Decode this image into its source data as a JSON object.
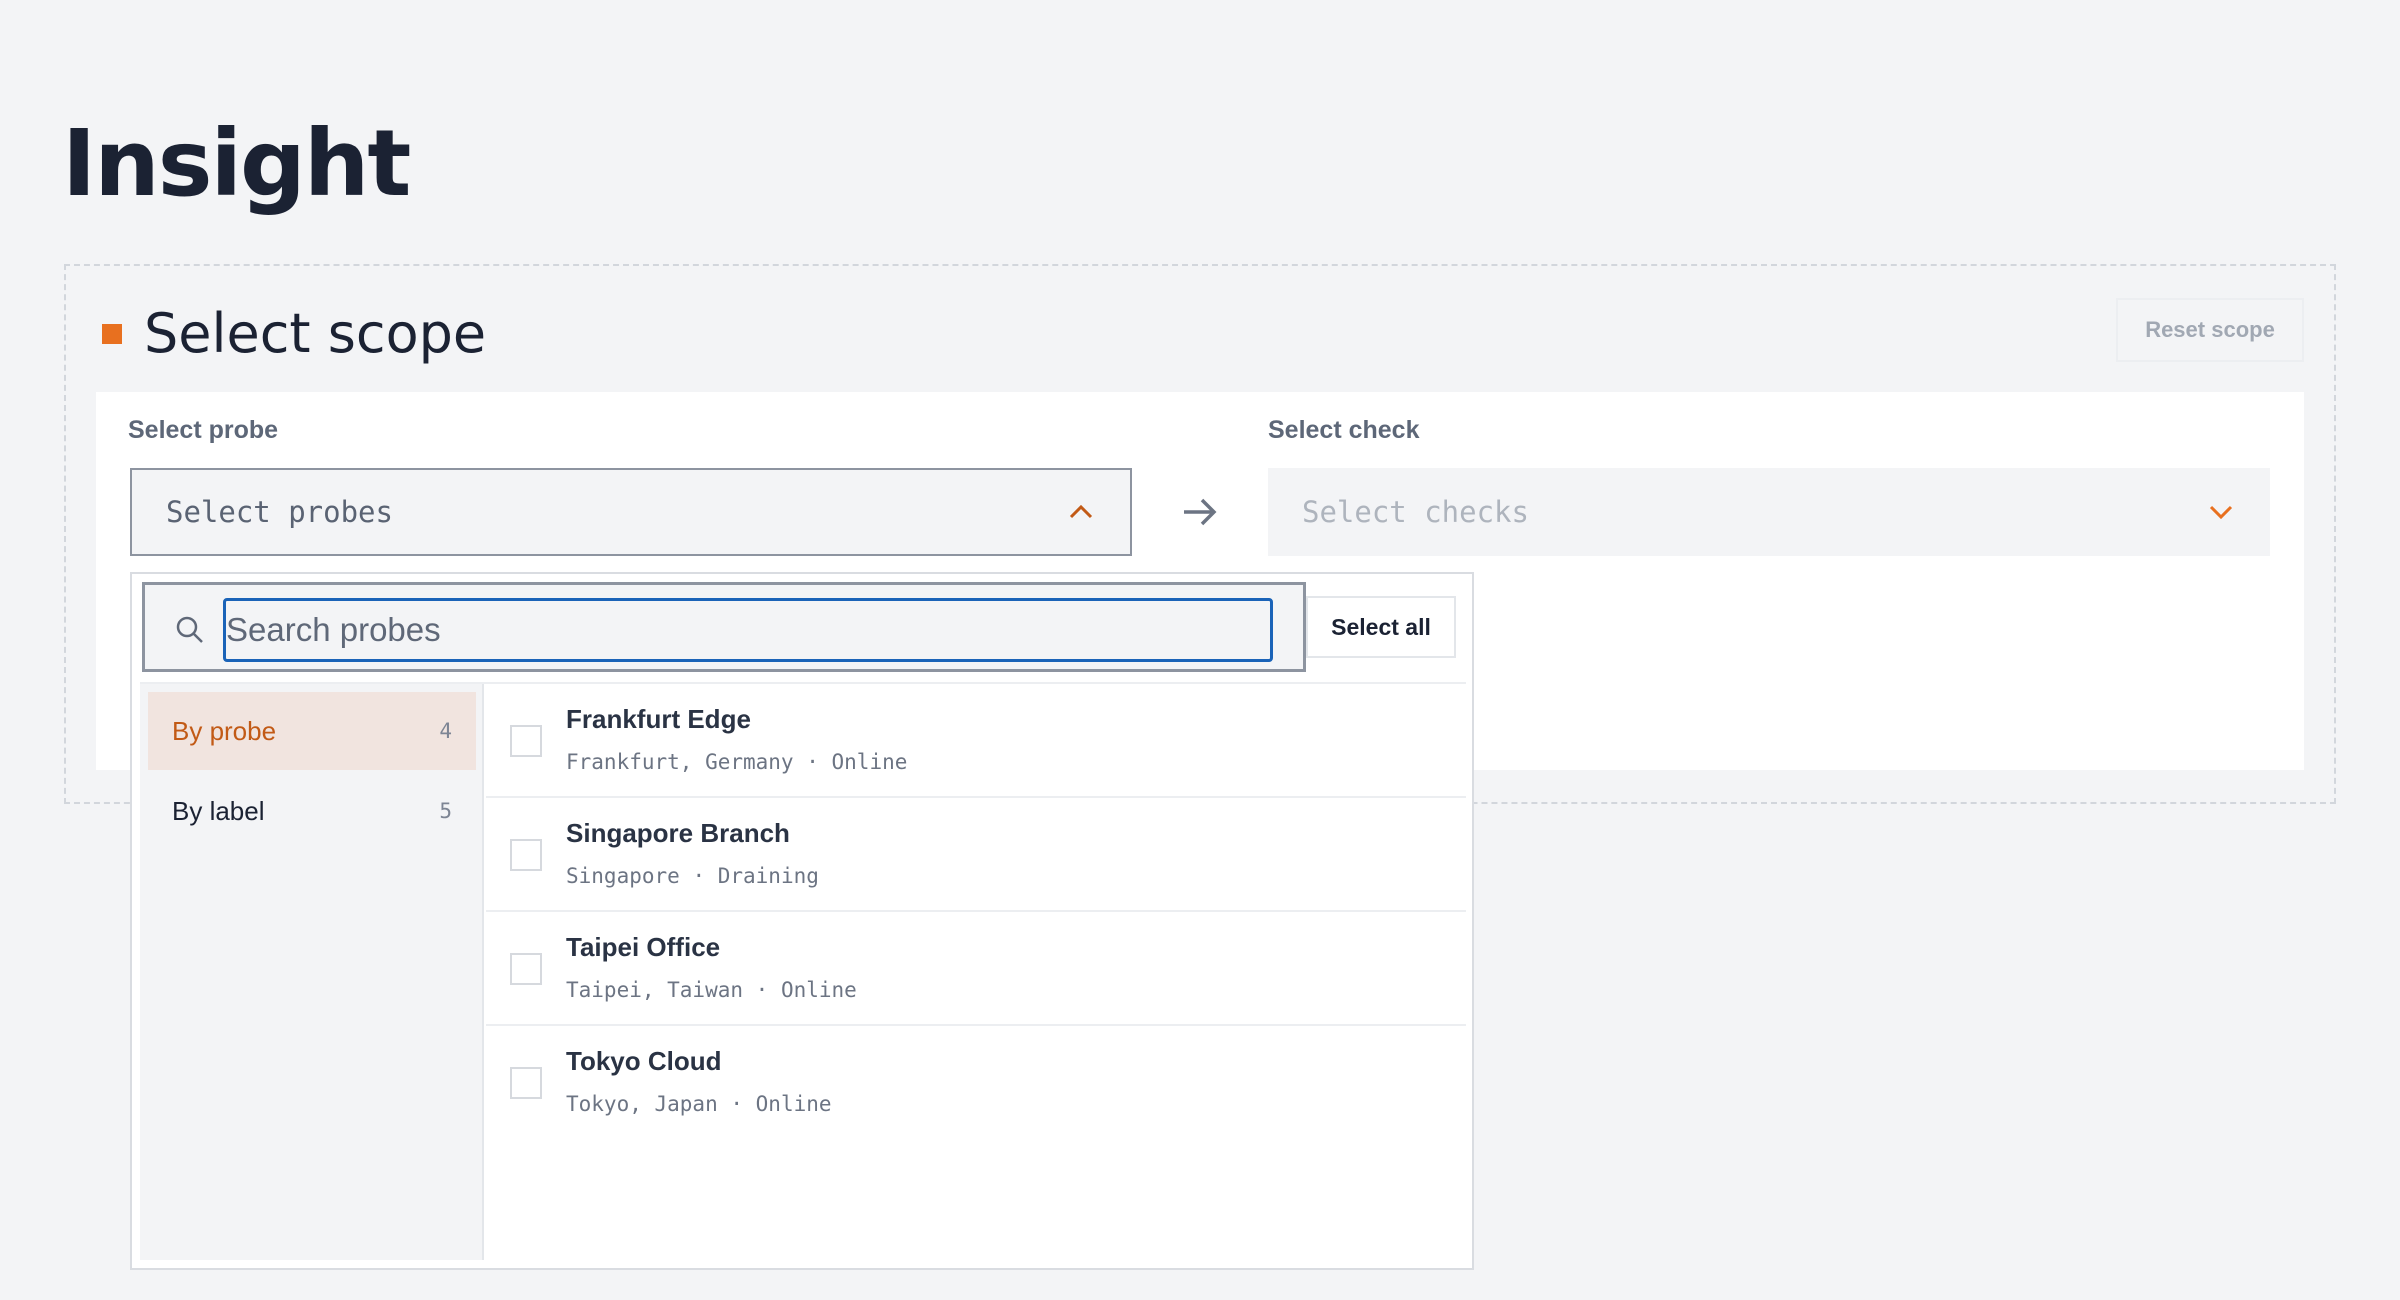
{
  "page": {
    "title": "Insight"
  },
  "scope": {
    "title": "Select scope",
    "reset_label": "Reset scope",
    "accent_color": "#e8701f"
  },
  "probe_field": {
    "label": "Select probe",
    "placeholder": "Select probes",
    "expanded": true
  },
  "check_field": {
    "label": "Select check",
    "placeholder": "Select checks",
    "expanded": false
  },
  "dropdown": {
    "search_placeholder": "Search probes",
    "search_value": "",
    "select_all_label": "Select all",
    "groups": [
      {
        "label": "By probe",
        "count": "4",
        "active": true
      },
      {
        "label": "By label",
        "count": "5",
        "active": false
      }
    ],
    "probes": [
      {
        "name": "Frankfurt Edge",
        "location": "Frankfurt, Germany",
        "status": "Online",
        "checked": false
      },
      {
        "name": "Singapore Branch",
        "location": "Singapore",
        "status": "Draining",
        "checked": false
      },
      {
        "name": "Taipei Office",
        "location": "Taipei, Taiwan",
        "status": "Online",
        "checked": false
      },
      {
        "name": "Tokyo Cloud",
        "location": "Tokyo, Japan",
        "status": "Online",
        "checked": false
      }
    ]
  },
  "icons": {
    "arrow": "arrow-right-icon",
    "search": "search-icon",
    "probe_chevron": "chevron-up-icon",
    "check_chevron": "chevron-down-icon"
  },
  "colors": {
    "focus_border": "#1a63b8",
    "active_group_bg": "#f1e4df",
    "active_group_text": "#c25a16"
  }
}
